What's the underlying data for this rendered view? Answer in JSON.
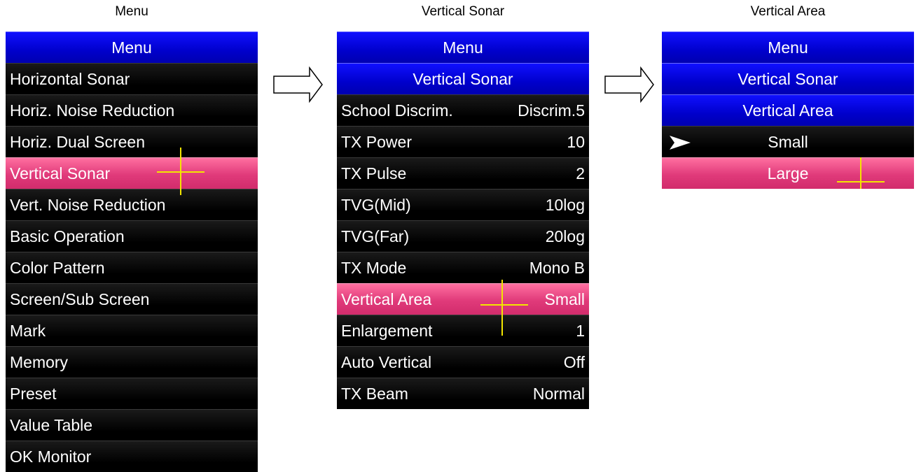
{
  "panels": {
    "menu": {
      "caption": "Menu",
      "header": "Menu",
      "items": [
        {
          "label": "Horizontal Sonar"
        },
        {
          "label": "Horiz. Noise Reduction"
        },
        {
          "label": "Horiz. Dual Screen"
        },
        {
          "label": "Vertical Sonar"
        },
        {
          "label": "Vert. Noise Reduction"
        },
        {
          "label": "Basic Operation"
        },
        {
          "label": "Color Pattern"
        },
        {
          "label": "Screen/Sub Screen"
        },
        {
          "label": "Mark"
        },
        {
          "label": "Memory"
        },
        {
          "label": "Preset"
        },
        {
          "label": "Value Table"
        },
        {
          "label": "OK Monitor"
        }
      ],
      "selected_item": "Vertical Sonar"
    },
    "vertical_sonar": {
      "caption": "Vertical Sonar",
      "headers": [
        "Menu",
        "Vertical Sonar"
      ],
      "items": [
        {
          "label": "School Discrim.",
          "value": "Discrim.5"
        },
        {
          "label": "TX Power",
          "value": "10"
        },
        {
          "label": "TX Pulse",
          "value": "2"
        },
        {
          "label": "TVG(Mid)",
          "value": "10log"
        },
        {
          "label": "TVG(Far)",
          "value": "20log"
        },
        {
          "label": "TX Mode",
          "value": "Mono B"
        },
        {
          "label": "Vertical Area",
          "value": "Small"
        },
        {
          "label": "Enlargement",
          "value": "1"
        },
        {
          "label": "Auto Vertical",
          "value": "Off"
        },
        {
          "label": "TX Beam",
          "value": "Normal"
        }
      ],
      "selected_item": "Vertical Area"
    },
    "vertical_area": {
      "caption": "Vertical Area",
      "headers": [
        "Menu",
        "Vertical Sonar",
        "Vertical Area"
      ],
      "options": [
        {
          "label": "Small",
          "current": true
        },
        {
          "label": "Large",
          "current": false
        }
      ],
      "selected_option": "Large"
    }
  },
  "colors": {
    "header_blue": "#0000cc",
    "selected_pink": "#e03a7a",
    "row_black": "#000000",
    "cursor_yellow": "#f2e600"
  },
  "icons": {
    "flow_arrow": "right-arrow-outline-icon",
    "current_marker": "pointer-arrow-icon",
    "cursor": "crosshair-cursor-icon"
  }
}
